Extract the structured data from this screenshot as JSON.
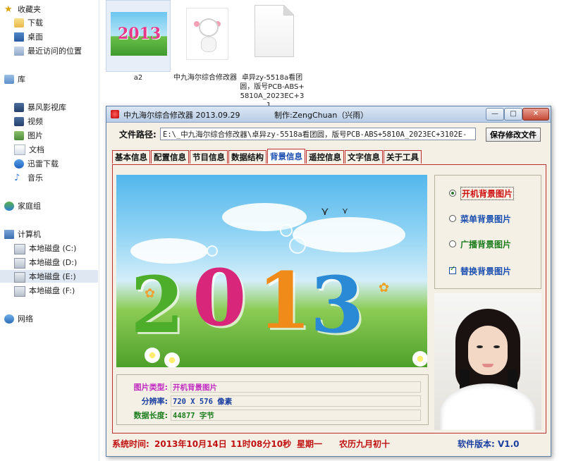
{
  "nav": {
    "favorites": "收藏夹",
    "downloads": "下载",
    "desktop": "桌面",
    "recent": "最近访问的位置",
    "library": "库",
    "storm": "暴风影视库",
    "video": "视频",
    "pictures": "图片",
    "documents": "文档",
    "thunder": "迅雷下载",
    "music": "音乐",
    "homegroup": "家庭组",
    "computer": "计算机",
    "drive_c": "本地磁盘 (C:)",
    "drive_d": "本地磁盘 (D:)",
    "drive_e": "本地磁盘 (E:)",
    "drive_f": "本地磁盘 (F:)",
    "network": "网络"
  },
  "files": [
    {
      "label": "a2",
      "icon": "image-thumbnail-2013"
    },
    {
      "label": "中九海尔综合修改器",
      "icon": "sheep-app-icon"
    },
    {
      "label": "卓异zy-5518a看团圆，版号PCB-ABS+5810A_2023EC+31...",
      "icon": "blank-file-icon"
    }
  ],
  "app": {
    "title": "中九海尔综合修改器 2013.09.29",
    "author": "制作:ZengChuan（兴雨）",
    "path_label": "文件路径:",
    "path_value": "E:\\_中九海尔综合修改器\\卓异zy-5518a看团圆，版号PCB-ABS+5810A_2023EC+3102E-",
    "save_button": "保存修改文件",
    "tabs": [
      "基本信息",
      "配置信息",
      "节目信息",
      "数据结构",
      "背景信息",
      "遥控信息",
      "文字信息",
      "关于工具"
    ],
    "active_tab": "背景信息",
    "image_digits": "2013",
    "options": [
      {
        "label": "开机背景图片",
        "type": "radio",
        "checked": true,
        "color": "#d01010"
      },
      {
        "label": "菜单背景图片",
        "type": "radio",
        "checked": false,
        "color": "#1b4fb0"
      },
      {
        "label": "广播背景图片",
        "type": "radio",
        "checked": false,
        "color": "#1d7d1d"
      },
      {
        "label": "替换背景图片",
        "type": "checkbox",
        "checked": true,
        "color": "#1b4fb0"
      }
    ],
    "info": {
      "type_label": "图片类型:",
      "type_value": "开机背景图片",
      "res_label": "分辨率:",
      "res_value": "720 X 576 像素",
      "len_label": "数据长度:",
      "len_value": "44877 字节"
    },
    "status": {
      "time_label": "系统时间:",
      "date": "2013年10月14日",
      "time": "11时08分10秒",
      "weekday": "星期一",
      "lunar": "农历九月初十",
      "version": "软件版本: V1.0"
    }
  },
  "colors": {
    "tab_border": "#c03030",
    "window_bg": "#f4f0e6",
    "status_red": "#c01010",
    "version_blue": "#1b3fa0"
  }
}
